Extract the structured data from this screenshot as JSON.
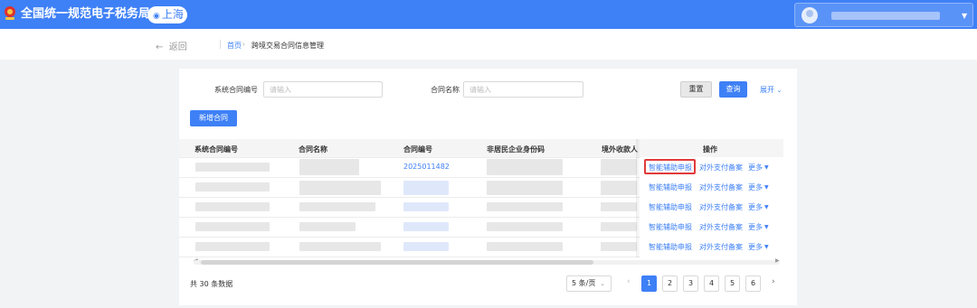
{
  "header": {
    "site_title": "全国统一规范电子税务局",
    "region": "上海"
  },
  "breadcrumb": {
    "back": "返回",
    "home": "首页",
    "current": "跨境交易合同信息管理"
  },
  "search": {
    "contract_sys_no_label": "系统合同编号",
    "contract_sys_no_placeholder": "请输入",
    "contract_name_label": "合同名称",
    "contract_name_placeholder": "请输入",
    "reset": "重置",
    "query": "查询",
    "expand": "展开"
  },
  "actions": {
    "add_contract": "新增合同"
  },
  "table": {
    "columns": [
      "系统合同编号",
      "合同名称",
      "合同编号",
      "非居民企业身份码",
      "境外收款人",
      "操作"
    ],
    "first_row_contract_no": "2025011482",
    "row_actions": {
      "smart_declare": "智能辅助申报",
      "filing": "对外支付备案",
      "more": "更多"
    },
    "row_count": 5
  },
  "pagination": {
    "total": "共 30 条数据",
    "page_size": "5 条/页",
    "pages": [
      "1",
      "2",
      "3",
      "4",
      "5",
      "6"
    ],
    "current_page": "1"
  },
  "colors": {
    "primary": "#3e80f6",
    "highlight": "#e03a3a"
  },
  "icons": {
    "emblem": "national-emblem-icon",
    "location": "location-pin-icon",
    "avatar": "user-avatar-icon",
    "dropdown": "caret-down-icon"
  }
}
